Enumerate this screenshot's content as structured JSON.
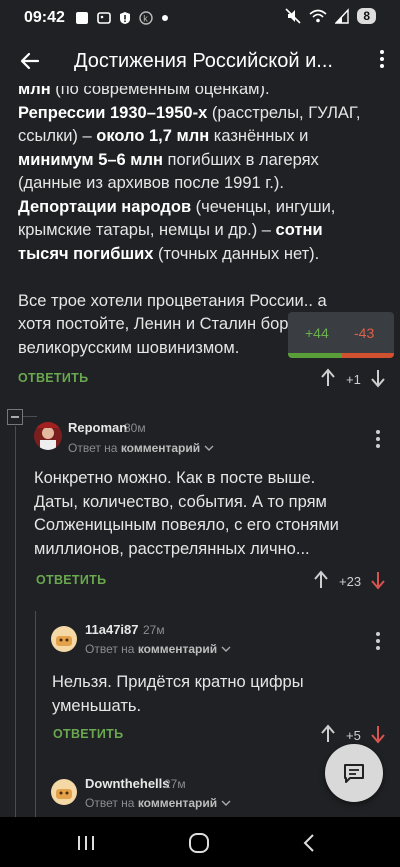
{
  "status": {
    "time": "09:42",
    "battery": "8"
  },
  "appbar": {
    "title": "Достижения Российской и..."
  },
  "post": {
    "line0_a": "млн",
    "line0_b": " (по современным оценкам).",
    "repr_bold": "Репрессии 1930–1950-х",
    "repr_rest": " (расстрелы, ГУЛАГ,",
    "repr_line2a": "ссылки) – ",
    "repr_bold2": "около 1,7 млн",
    "repr_line2b": " казнённых и",
    "repr_bold3": "минимум 5–6 млн",
    "repr_line3b": " погибших в лагерях",
    "repr_line4": "(данные из архивов после 1991 г.).",
    "dep_bold": "Депортации народов",
    "dep_rest": " (чеченцы, ингуши,",
    "dep_line2a": "крымские татары, немцы и др.) – ",
    "dep_bold2": "сотни",
    "dep_bold3": "тысяч погибших",
    "dep_line3b": " (точных данных нет).",
    "para_line1": "Все трое хотели процветания России.. а",
    "para_line2": "хотя постойте, Ленин и Сталин бор",
    "para_line3": "великорусским шовинизмом.",
    "reply_label": "ОТВЕТИТЬ",
    "score": "+1",
    "rating_positive": "+44",
    "rating_negative": "-43"
  },
  "comments": [
    {
      "username": "Repoman",
      "time": "30м",
      "reply_to_prefix": "Ответ на ",
      "reply_to_target": "комментарий",
      "text_lines": [
        "Конкретно можно. Как в посте выше.",
        "Даты, количество, события. А то прям",
        "Солженицыным повеяло, с его стонями",
        "миллионов, расстрелянных лично..."
      ],
      "reply_label": "ОТВЕТИТЬ",
      "score": "+23"
    },
    {
      "username": "11a47i87",
      "time": "27м",
      "reply_to_prefix": "Ответ на ",
      "reply_to_target": "комментарий",
      "text_lines": [
        "Нельзя. Придётся кратно цифры",
        "уменьшать."
      ],
      "reply_label": "ОТВЕТИТЬ",
      "score": "+5"
    },
    {
      "username": "Downthehells",
      "time": "27м",
      "reply_to_prefix": "Ответ на ",
      "reply_to_target": "комментарий"
    }
  ],
  "colors": {
    "background": "#1f2124",
    "accent_green": "#6aa84f",
    "downvote_red": "#d9534f"
  }
}
